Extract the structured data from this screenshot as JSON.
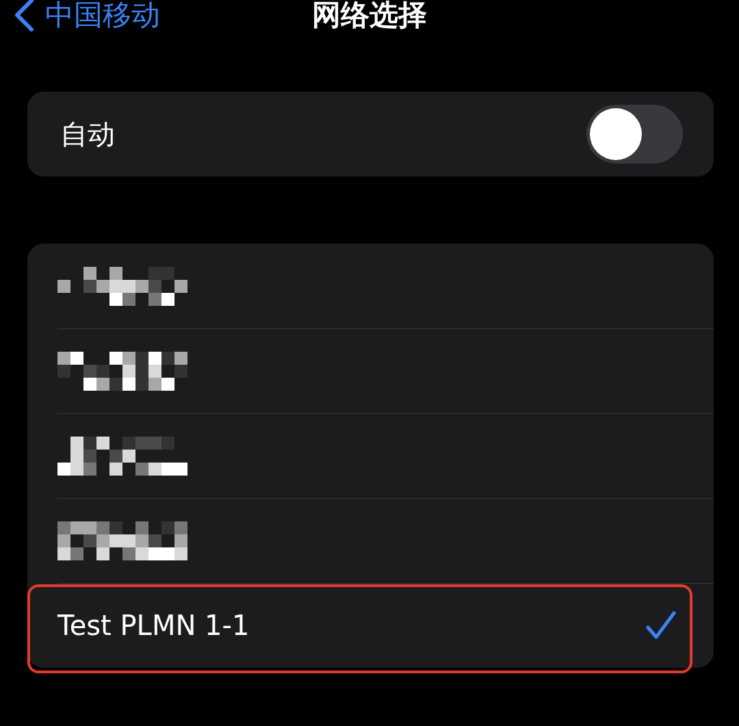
{
  "nav": {
    "back_label": "中国移动",
    "title": "网络选择"
  },
  "automatic": {
    "label": "自动",
    "on": false
  },
  "networks": [
    {
      "kind": "redacted",
      "selected": false,
      "highlighted": false
    },
    {
      "kind": "redacted",
      "selected": false,
      "highlighted": false
    },
    {
      "kind": "redacted",
      "selected": false,
      "highlighted": false
    },
    {
      "kind": "redacted",
      "selected": false,
      "highlighted": false
    },
    {
      "kind": "named",
      "name": "Test PLMN 1-1",
      "selected": true,
      "highlighted": true
    }
  ]
}
